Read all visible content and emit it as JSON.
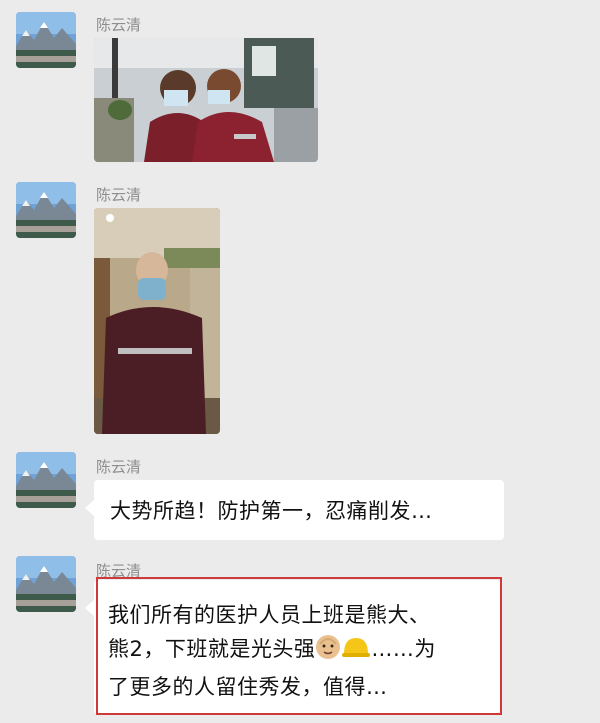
{
  "messages": [
    {
      "sender": "陈云清",
      "type": "image",
      "avatar_icon": "mountain-lake-avatar",
      "image_desc_icon": "photo-two-medical-staff-masks"
    },
    {
      "sender": "陈云清",
      "type": "image",
      "avatar_icon": "mountain-lake-avatar",
      "image_desc_icon": "photo-shaved-head-medic"
    },
    {
      "sender": "陈云清",
      "type": "text",
      "avatar_icon": "mountain-lake-avatar",
      "text": "大势所趋！防护第一，忍痛削发…"
    },
    {
      "sender": "陈云清",
      "type": "text",
      "avatar_icon": "mountain-lake-avatar",
      "text_line1": "我们所有的医护人员上班是熊大、",
      "text_line2_a": "熊2，下班就是光头强",
      "text_line2_b": "……为",
      "text_line3": "了更多的人留住秀发，值得…",
      "emoji1_icon": "bald-man-emoji",
      "emoji2_icon": "hard-hat-emoji"
    }
  ],
  "colors": {
    "background": "#ebebeb",
    "bubble": "#ffffff",
    "highlight_border": "#d0393a",
    "sender_text": "#8e8e8e"
  }
}
